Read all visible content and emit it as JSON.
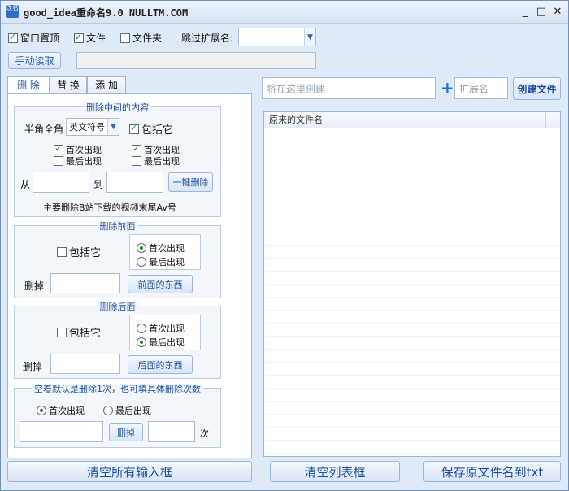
{
  "window": {
    "title": "good_idea重命名9.0 NULLTM.COM",
    "icon_text": "改名",
    "controls": {
      "minimize": "_",
      "maximize": "□",
      "close": "✕"
    }
  },
  "top": {
    "always_on_top": {
      "label": "窗口置顶",
      "checked": true
    },
    "files": {
      "label": "文件",
      "checked": true
    },
    "folders": {
      "label": "文件夹",
      "checked": false
    },
    "skip_ext_label": "跳过扩展名:",
    "skip_ext_value": "",
    "manual_read_button": "手动读取",
    "path_value": ""
  },
  "tabs": [
    "删 除",
    "替 换",
    "添 加"
  ],
  "delete_middle": {
    "title": "删除中间的内容",
    "width_label": "半角全角",
    "width_select": "英文符号",
    "include_label": "包括它",
    "include_checked": true,
    "left_first": {
      "label": "首次出现",
      "checked": true
    },
    "left_last": {
      "label": "最后出现",
      "checked": false
    },
    "right_first": {
      "label": "首次出现",
      "checked": true
    },
    "right_last": {
      "label": "最后出现",
      "checked": false
    },
    "from_label": "从",
    "to_label": "到",
    "from_value": "",
    "to_value": "",
    "one_click_button": "一键删除",
    "hint": "主要删除B站下载的视频末尾Av号"
  },
  "delete_before": {
    "title": "删除前面",
    "include_label": "包括它",
    "include_checked": false,
    "first_label": "首次出现",
    "last_label": "最后出现",
    "selected": "first",
    "delete_label": "删掉",
    "value": "",
    "button": "前面的东西"
  },
  "delete_after": {
    "title": "删除后面",
    "include_label": "包括它",
    "include_checked": false,
    "first_label": "首次出现",
    "last_label": "最后出现",
    "selected": "last",
    "delete_label": "删掉",
    "value": "",
    "button": "后面的东西"
  },
  "delete_count": {
    "title": "空着默认是删除1次，也可填具体删除次数",
    "first_label": "首次出现",
    "last_label": "最后出现",
    "selected": "first",
    "value": "",
    "button": "删掉",
    "count_value": "",
    "count_suffix": "次"
  },
  "create": {
    "name_placeholder": "将在这里创建",
    "plus": "+",
    "ext_placeholder": "扩展名",
    "button": "创建文件"
  },
  "list": {
    "column": "原来的文件名",
    "rows": []
  },
  "bottom": {
    "clear_inputs": "清空所有输入框",
    "clear_list": "清空列表框",
    "save_txt": "保存原文件名到txt"
  }
}
